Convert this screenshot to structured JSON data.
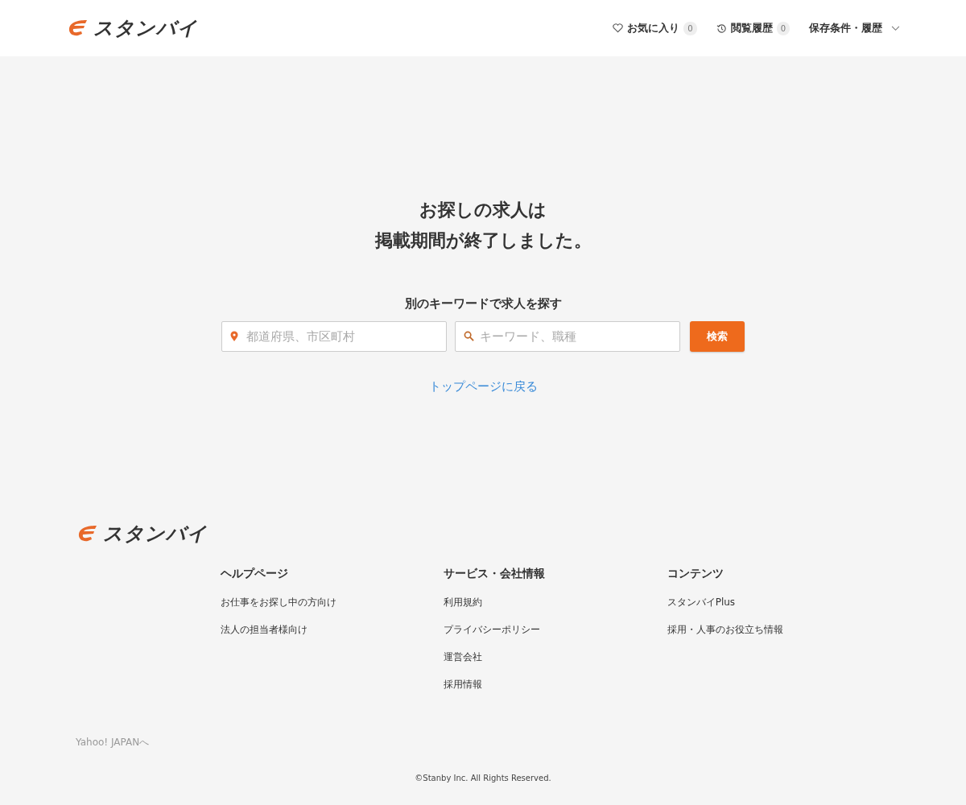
{
  "header": {
    "logo": "スタンバイ",
    "nav": [
      {
        "kind": "favorites",
        "label": "お気に入り",
        "count": "0"
      },
      {
        "kind": "history",
        "label": "閲覧履歴",
        "count": "0"
      },
      {
        "kind": "dropdown",
        "label": "保存条件・履歴"
      }
    ]
  },
  "main": {
    "title_lines": [
      "お探しの求人は",
      "掲載期間が終了しました。"
    ],
    "search_heading": "別のキーワードで求人を探す",
    "location_placeholder": "都道府県、市区町村",
    "keyword_placeholder": "キーワード、職種",
    "search_button": "検索",
    "back_link": "トップページに戻る"
  },
  "footer": {
    "logo": "スタンバイ",
    "columns": [
      {
        "heading": "ヘルプページ",
        "links": [
          "お仕事をお探し中の方向け",
          "法人の担当者様向け"
        ]
      },
      {
        "heading": "サービス・会社情報",
        "links": [
          "利用規約",
          "プライバシーポリシー",
          "運営会社",
          "採用情報"
        ]
      },
      {
        "heading": "コンテンツ",
        "links": [
          "スタンバイPlus",
          "採用・人事のお役立ち情報"
        ]
      }
    ],
    "yahoo_link": "Yahoo! JAPANへ",
    "copyright": "©Stanby Inc. All Rights Reserved."
  }
}
